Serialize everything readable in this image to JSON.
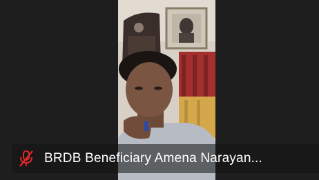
{
  "participant": {
    "name": "BRDB Beneficiary Amena Narayan...",
    "mic_status": "muted",
    "mic_icon": "mic-muted-icon"
  },
  "colors": {
    "tile_background": "#1e1e1e",
    "mic_muted": "#e02828",
    "name_text": "#ffffff"
  }
}
